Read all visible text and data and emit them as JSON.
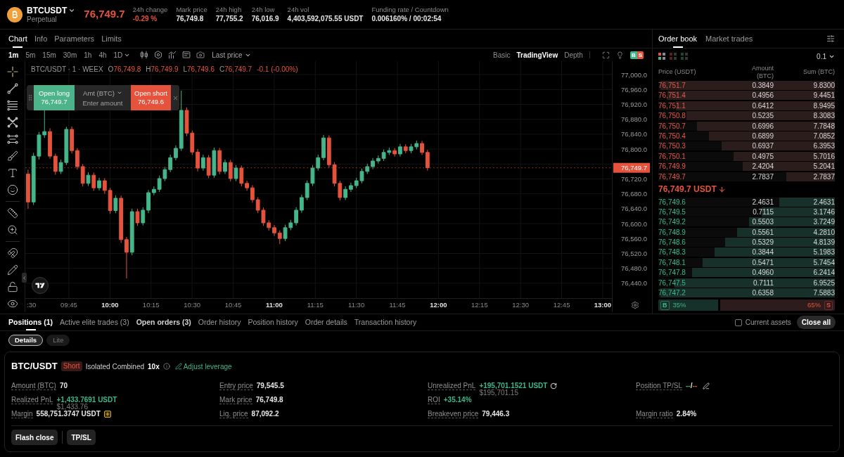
{
  "header": {
    "symbol": "BTCUSDT",
    "contract_type": "Perpetual",
    "last_price": "76,749.7",
    "last_price_falling": true,
    "stats": [
      {
        "label": "24h change",
        "value": "-0.29 %",
        "kind": "down"
      },
      {
        "label": "Mark price",
        "value": "76,749.8",
        "kind": "plain"
      },
      {
        "label": "24h high",
        "value": "77,755.2",
        "kind": "plain"
      },
      {
        "label": "24h low",
        "value": "76,016.9",
        "kind": "plain"
      },
      {
        "label": "24h vol",
        "value": "4,403,592,075.55 USDT",
        "kind": "plain"
      },
      {
        "label": "Funding rate / Countdown",
        "value": "0.006160% / 00:02:54",
        "kind": "plain"
      }
    ]
  },
  "chart_panel": {
    "tabs": [
      {
        "label": "Chart",
        "selected": true
      },
      {
        "label": "Info",
        "selected": false
      },
      {
        "label": "Parameters",
        "selected": false
      },
      {
        "label": "Limits",
        "selected": false
      }
    ],
    "intervals": [
      {
        "label": "1m",
        "kind": "interval",
        "selected": true
      },
      {
        "label": "5m",
        "kind": "interval",
        "selected": false
      },
      {
        "label": "15m",
        "kind": "interval",
        "selected": false
      },
      {
        "label": "30m",
        "kind": "interval",
        "selected": false
      },
      {
        "label": "1h",
        "kind": "interval",
        "selected": false
      },
      {
        "label": "4h",
        "kind": "interval",
        "selected": false
      },
      {
        "label": "1D",
        "kind": "menu",
        "selected": false
      }
    ],
    "price_source": "Last price",
    "views": [
      {
        "label": "Basic",
        "selected": false
      },
      {
        "label": "TradingView",
        "selected": true
      },
      {
        "label": "Depth",
        "selected": false
      }
    ],
    "buy_sell_toggle": {
      "buy": "B",
      "sell": "S"
    },
    "legend": {
      "title": "BTC/USDT · 1 · WEEX",
      "ohlc": [
        {
          "prefix": "O",
          "value": "76,749.8"
        },
        {
          "prefix": "H",
          "value": "76,749.9"
        },
        {
          "prefix": "L",
          "value": "76,749.6"
        },
        {
          "prefix": "C",
          "value": "76,749.7"
        }
      ],
      "change": "-0.1 (-0.00%)",
      "falling": true
    },
    "quick_trade": {
      "long_label": "Open long",
      "long_price": "76,749.7",
      "unit": "Amt (BTC)",
      "amount_placeholder": "Enter amount",
      "short_label": "Open short",
      "short_price": "76,749.6"
    },
    "price_axis": [
      {
        "kind": "tick",
        "label": "77,000.0"
      },
      {
        "kind": "tick",
        "label": "76,960.0"
      },
      {
        "kind": "tick",
        "label": "76,920.0"
      },
      {
        "kind": "tick",
        "label": "76,880.0"
      },
      {
        "kind": "tick",
        "label": "76,840.0"
      },
      {
        "kind": "tick",
        "label": "76,800.0"
      },
      {
        "kind": "last_price",
        "label": "76,749.7"
      },
      {
        "kind": "tick",
        "label": "76,720.0"
      },
      {
        "kind": "tick",
        "label": "76,680.0"
      },
      {
        "kind": "tick",
        "label": "76,640.0"
      },
      {
        "kind": "tick",
        "label": "76,600.0"
      },
      {
        "kind": "tick",
        "label": "76,560.0"
      },
      {
        "kind": "tick",
        "label": "76,520.0"
      },
      {
        "kind": "tick",
        "label": "76,480.0"
      },
      {
        "kind": "tick",
        "label": "76,440.0"
      }
    ],
    "time_axis": [
      {
        "label": ":30",
        "major": false
      },
      {
        "label": "09:45",
        "major": false
      },
      {
        "label": "10:00",
        "major": true
      },
      {
        "label": "10:15",
        "major": false
      },
      {
        "label": "10:30",
        "major": false
      },
      {
        "label": "10:45",
        "major": false
      },
      {
        "label": "11:00",
        "major": true
      },
      {
        "label": "11:15",
        "major": false
      },
      {
        "label": "11:30",
        "major": false
      },
      {
        "label": "11:45",
        "major": false
      },
      {
        "label": "12:00",
        "major": true
      },
      {
        "label": "12:15",
        "major": false
      },
      {
        "label": "12:30",
        "major": false
      },
      {
        "label": "12:45",
        "major": false
      },
      {
        "label": "13:00",
        "major": true
      }
    ]
  },
  "order_book": {
    "tabs": [
      {
        "label": "Order book",
        "selected": true
      },
      {
        "label": "Market trades",
        "selected": false
      }
    ],
    "layouts": [
      {
        "kind": "both",
        "selected": true
      },
      {
        "kind": "asks",
        "selected": false
      },
      {
        "kind": "bids",
        "selected": false
      }
    ],
    "precision": "0.1",
    "columns": [
      "Price (USDT)",
      "Amount (BTC)",
      "Sum (BTC)"
    ],
    "asks": [
      {
        "price": "76,751.7",
        "amount": "0.3849",
        "sum": "9.8300",
        "level": 1.0
      },
      {
        "price": "76,751.4",
        "amount": "0.4956",
        "sum": "9.4451",
        "level": 0.96
      },
      {
        "price": "76,751.1",
        "amount": "0.6412",
        "sum": "8.9495",
        "level": 0.91
      },
      {
        "price": "76,750.8",
        "amount": "0.5235",
        "sum": "8.3083",
        "level": 0.85
      },
      {
        "price": "76,750.7",
        "amount": "0.6996",
        "sum": "7.7848",
        "level": 0.79
      },
      {
        "price": "76,750.4",
        "amount": "0.6899",
        "sum": "7.0852",
        "level": 0.72
      },
      {
        "price": "76,750.3",
        "amount": "0.6937",
        "sum": "6.3953",
        "level": 0.65
      },
      {
        "price": "76,750.1",
        "amount": "0.4975",
        "sum": "5.7016",
        "level": 0.58
      },
      {
        "price": "76,749.9",
        "amount": "2.4204",
        "sum": "5.2041",
        "level": 0.53
      },
      {
        "price": "76,749.7",
        "amount": "2.7837",
        "sum": "2.7837",
        "level": 0.28
      }
    ],
    "last_price": "76,749.7 USDT",
    "falling": true,
    "bids": [
      {
        "price": "76,749.6",
        "amount": "2.4631",
        "sum": "2.4631",
        "level": 0.32
      },
      {
        "price": "76,749.5",
        "amount": "0.7115",
        "sum": "3.1746",
        "level": 0.42
      },
      {
        "price": "76,749.2",
        "amount": "0.5503",
        "sum": "3.7249",
        "level": 0.49
      },
      {
        "price": "76,748.9",
        "amount": "0.5561",
        "sum": "4.2810",
        "level": 0.56
      },
      {
        "price": "76,748.6",
        "amount": "0.5329",
        "sum": "4.8139",
        "level": 0.63
      },
      {
        "price": "76,748.3",
        "amount": "0.3844",
        "sum": "5.1983",
        "level": 0.69
      },
      {
        "price": "76,748.1",
        "amount": "0.5471",
        "sum": "5.7454",
        "level": 0.76
      },
      {
        "price": "76,747.8",
        "amount": "0.4960",
        "sum": "6.2414",
        "level": 0.82
      },
      {
        "price": "76,747.5",
        "amount": "0.7111",
        "sum": "6.9525",
        "level": 0.92
      },
      {
        "price": "76,747.2",
        "amount": "0.6358",
        "sum": "7.5883",
        "level": 1.0
      }
    ],
    "ratio": {
      "buy": "B",
      "buy_share": "35%",
      "sell_share": "65%",
      "sell": "S",
      "level": 0.35
    }
  },
  "positions_panel": {
    "tabs": [
      {
        "label": "Positions (1)",
        "selected": true,
        "emphasized": true
      },
      {
        "label": "Active elite trades (3)",
        "selected": false,
        "emphasized": false
      },
      {
        "label": "Open orders (3)",
        "selected": false,
        "emphasized": true
      },
      {
        "label": "Order history",
        "selected": false,
        "emphasized": false
      },
      {
        "label": "Position history",
        "selected": false,
        "emphasized": false
      },
      {
        "label": "Order details",
        "selected": false,
        "emphasized": false
      },
      {
        "label": "Transaction history",
        "selected": false,
        "emphasized": false
      }
    ],
    "current_assets": {
      "label": "Current assets",
      "checked": false
    },
    "close_all": "Close all",
    "views": [
      {
        "label": "Details",
        "selected": true
      },
      {
        "label": "Lite",
        "selected": false
      }
    ],
    "position": {
      "symbol": "BTC/USDT",
      "side": "Short",
      "short": true,
      "margin_mode": "Isolated Combined",
      "leverage": "10x",
      "adjust_leverage": "Adjust leverage",
      "columns": [
        [
          {
            "kind": "plain",
            "label": "Amount (BTC)",
            "value": "70",
            "profit": false
          },
          {
            "kind": "pnl",
            "label": "Realized PnL",
            "value": "+1,433.7691 USDT",
            "sub": "$1,433.76",
            "profit": true
          },
          {
            "kind": "margin",
            "label": "Margin",
            "value": "558,751.3747 USDT",
            "profit": false
          }
        ],
        [
          {
            "kind": "plain",
            "label": "Entry price",
            "value": "79,545.5",
            "profit": false
          },
          {
            "kind": "plain",
            "label": "Mark price",
            "value": "76,749.8",
            "profit": false
          },
          {
            "kind": "plain",
            "label": "Liq. price",
            "value": "87,092.2",
            "profit": false
          }
        ],
        [
          {
            "kind": "pnl_share",
            "label": "Unrealized PnL",
            "value": "+195,701.1521 USDT",
            "sub": "$195,701.15",
            "profit": true
          },
          {
            "kind": "plain",
            "label": "ROI",
            "value": "+35.14%",
            "profit": true
          },
          {
            "kind": "plain",
            "label": "Breakeven price",
            "value": "79,446.3",
            "profit": false
          }
        ],
        [
          {
            "kind": "tpsl",
            "label": "Position TP/SL",
            "take_profit": "--",
            "separator": "/",
            "stop_loss": "--"
          },
          {
            "kind": "plain",
            "label": "Margin ratio",
            "value": "2.84%",
            "profit": false
          }
        ]
      ],
      "actions": [
        "Flash close",
        "TP/SL"
      ]
    }
  }
}
